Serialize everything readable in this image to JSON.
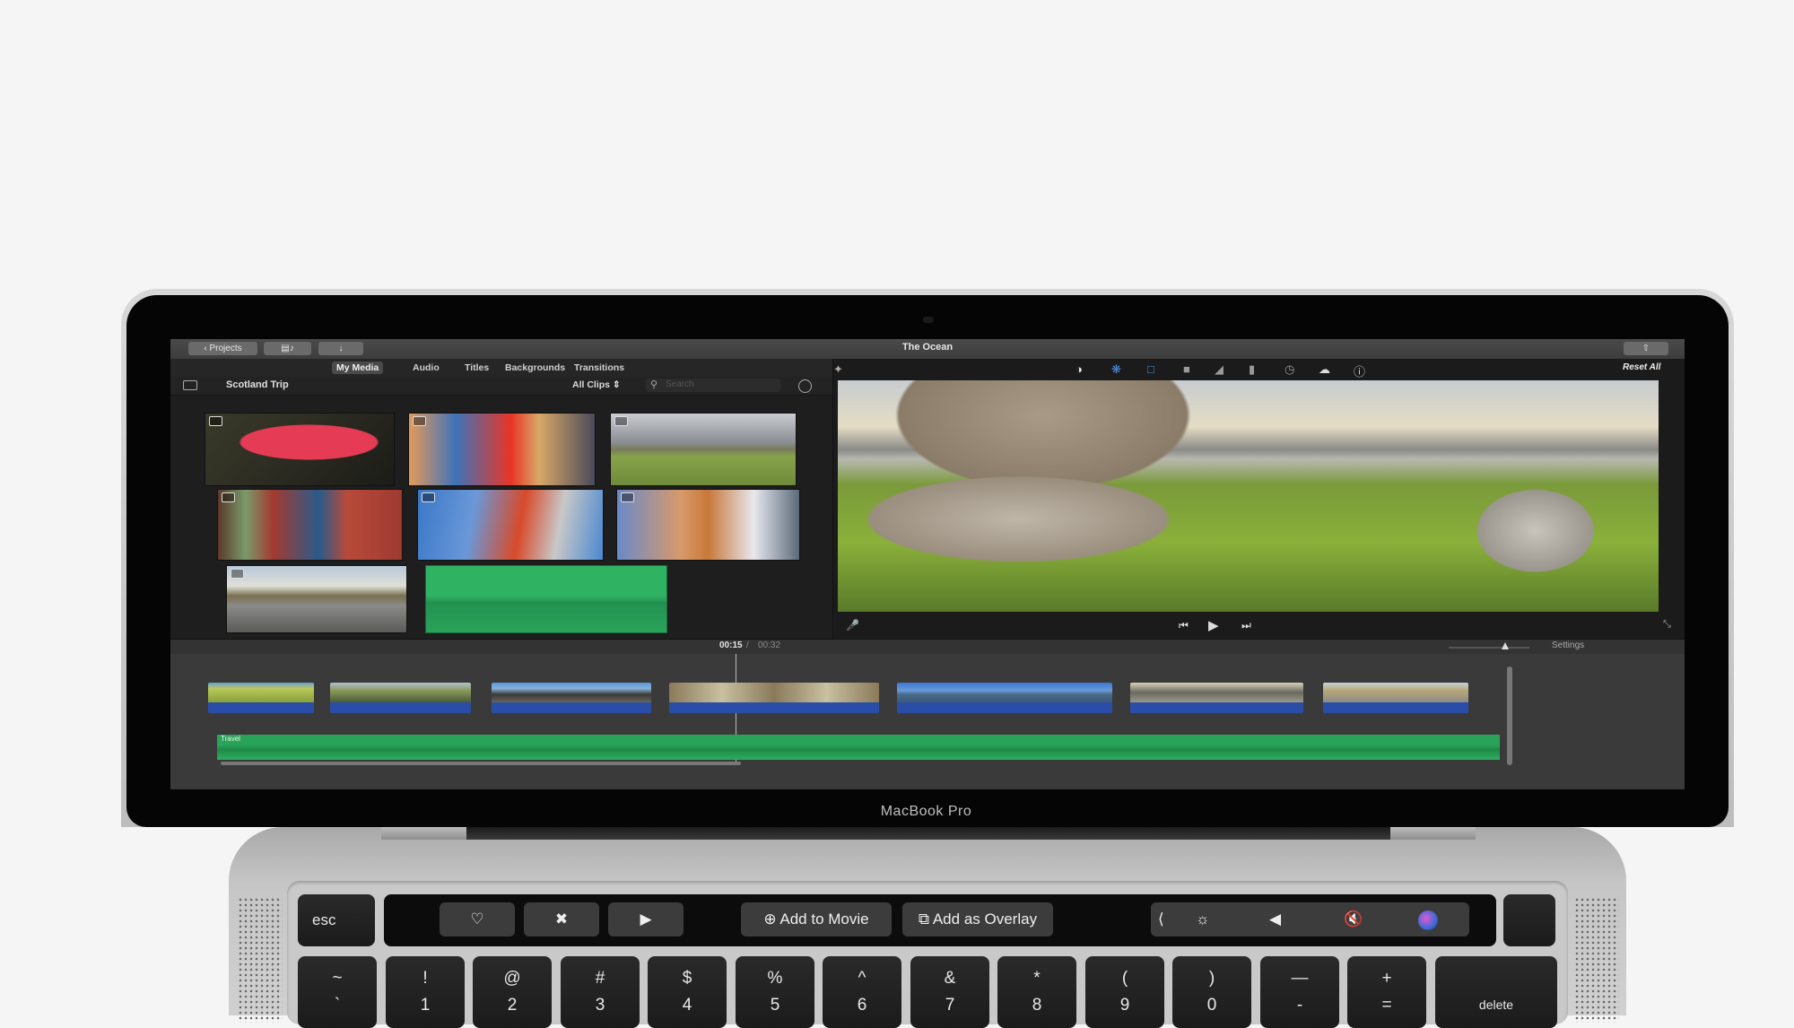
{
  "device": {
    "brand_label": "MacBook Pro"
  },
  "app": {
    "window_title": "The Ocean",
    "titlebar": {
      "projects_label": "Projects",
      "media_button_icon": "film-music-icon",
      "import_button_icon": "download-arrow-icon",
      "share_button_icon": "share-icon"
    },
    "browser": {
      "tabs": [
        {
          "label": "My Media",
          "active": true
        },
        {
          "label": "Audio",
          "active": false
        },
        {
          "label": "Titles",
          "active": false
        },
        {
          "label": "Backgrounds",
          "active": false
        },
        {
          "label": "Transitions",
          "active": false
        }
      ],
      "library_name": "Scotland Trip",
      "filter_label": "All Clips",
      "search_placeholder": "Search",
      "media_items": [
        {
          "name": "red-leaf-photo",
          "type": "photo"
        },
        {
          "name": "friends-group-photo",
          "type": "photo"
        },
        {
          "name": "moorland-stream-photo",
          "type": "photo"
        },
        {
          "name": "woman-red-room-photo",
          "type": "photo"
        },
        {
          "name": "woman-on-ladder-photo",
          "type": "photo"
        },
        {
          "name": "woman-profile-wind-photo",
          "type": "photo"
        },
        {
          "name": "rocky-shore-photo",
          "type": "photo"
        },
        {
          "name": "audio-clip",
          "type": "audio"
        }
      ]
    },
    "viewer": {
      "tools": [
        "magic-wand-icon",
        "color-balance-icon",
        "color-correction-icon",
        "crop-icon",
        "stabilization-icon",
        "volume-icon",
        "equalizer-icon",
        "speed-icon",
        "clip-filter-icon",
        "info-icon"
      ],
      "reset_label": "Reset All"
    },
    "timeline": {
      "current_time": "00:15",
      "separator": "/",
      "total_time": "00:32",
      "settings_label": "Settings",
      "zoom_level": 0.7,
      "audio_track_label": "Travel",
      "clips": [
        {
          "name": "grass-hills"
        },
        {
          "name": "moor-landscape"
        },
        {
          "name": "rocky-coast"
        },
        {
          "name": "rock-outcrop"
        },
        {
          "name": "ocean-lake"
        },
        {
          "name": "rocky-beach"
        },
        {
          "name": "reflective-shore"
        }
      ]
    }
  },
  "touchbar": {
    "esc_label": "esc",
    "favorite_icon": "heart-icon",
    "reject_icon": "reject-x-icon",
    "play_icon": "play-icon",
    "add_to_movie_label": "Add to Movie",
    "add_as_overlay_label": "Add as Overlay",
    "control_strip": [
      "chevron-left-icon",
      "brightness-icon",
      "volume-icon",
      "mute-icon",
      "siri-icon"
    ]
  },
  "keyboard": {
    "number_row": [
      {
        "shift": "~",
        "main": "`"
      },
      {
        "shift": "!",
        "main": "1"
      },
      {
        "shift": "@",
        "main": "2"
      },
      {
        "shift": "#",
        "main": "3"
      },
      {
        "shift": "$",
        "main": "4"
      },
      {
        "shift": "%",
        "main": "5"
      },
      {
        "shift": "^",
        "main": "6"
      },
      {
        "shift": "&",
        "main": "7"
      },
      {
        "shift": "*",
        "main": "8"
      },
      {
        "shift": "(",
        "main": "9"
      },
      {
        "shift": ")",
        "main": "0"
      },
      {
        "shift": "—",
        "main": "-"
      },
      {
        "shift": "+",
        "main": "="
      }
    ],
    "delete_label": "delete"
  },
  "colors": {
    "accent_blue": "#3b82f6",
    "clip_bar_blue": "#2a4ea8",
    "audio_green": "#2aa35a"
  }
}
